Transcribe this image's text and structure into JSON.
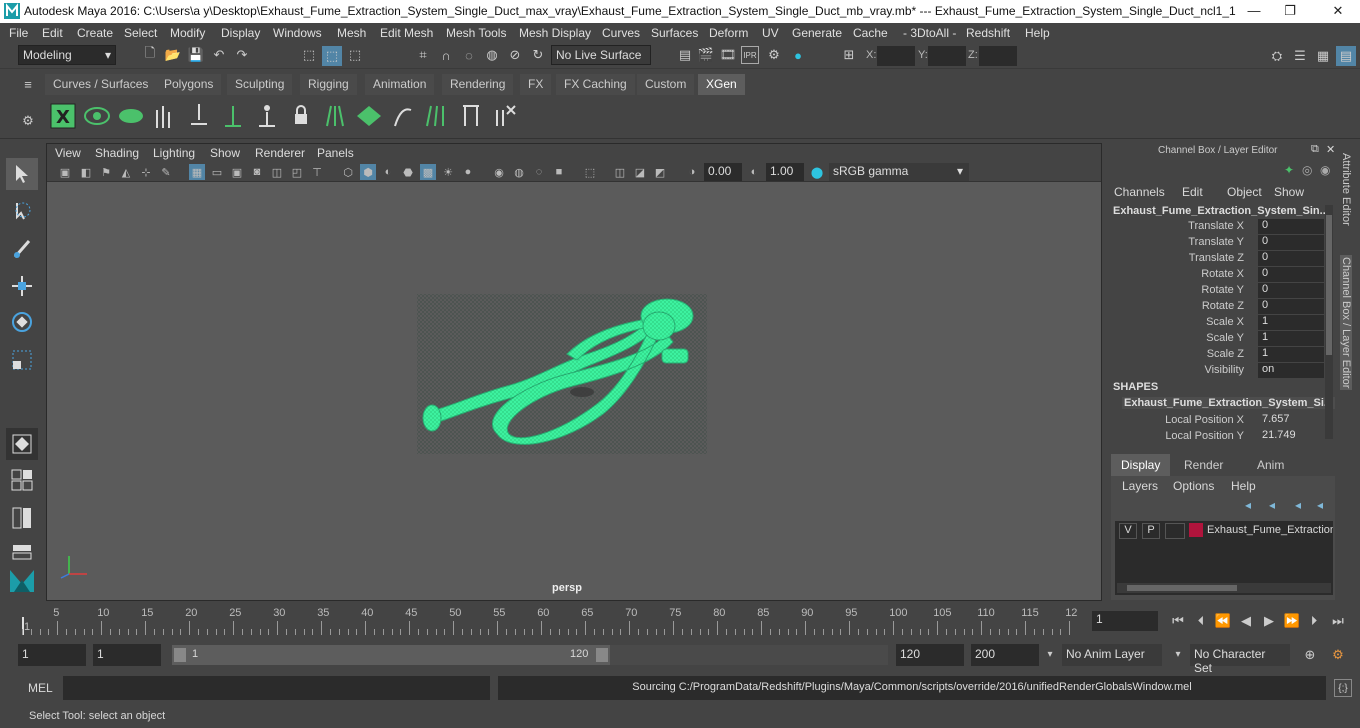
{
  "window": {
    "title": "Autodesk Maya 2016: C:\\Users\\a y\\Desktop\\Exhaust_Fume_Extraction_System_Single_Duct_max_vray\\Exhaust_Fume_Extraction_System_Single_Duct_mb_vray.mb*   ---   Exhaust_Fume_Extraction_System_Single_Duct_ncl1_1"
  },
  "menubar": [
    "File",
    "Edit",
    "Create",
    "Select",
    "Modify",
    "Display",
    "Windows",
    "Mesh",
    "Edit Mesh",
    "Mesh Tools",
    "Mesh Display",
    "Curves",
    "Surfaces",
    "Deform",
    "UV",
    "Generate",
    "Cache",
    "- 3DtoAll -",
    "Redshift",
    "Help"
  ],
  "status": {
    "mode": "Modeling",
    "live_surface": "No Live Surface",
    "x_label": "X:",
    "y_label": "Y:",
    "z_label": "Z:"
  },
  "shelf_tabs": [
    "Curves / Surfaces",
    "Polygons",
    "Sculpting",
    "Rigging",
    "Animation",
    "Rendering",
    "FX",
    "FX Caching",
    "Custom",
    "XGen"
  ],
  "active_shelf": "XGen",
  "viewport": {
    "menu": [
      "View",
      "Shading",
      "Lighting",
      "Show",
      "Renderer",
      "Panels"
    ],
    "exposure": "0.00",
    "gamma": "1.00",
    "color_space": "sRGB gamma",
    "camera": "persp"
  },
  "channel_box": {
    "header": "Channel Box / Layer Editor",
    "menu": [
      "Channels",
      "Edit",
      "Object",
      "Show"
    ],
    "object": "Exhaust_Fume_Extraction_System_Sin...",
    "attrs": [
      {
        "name": "Translate X",
        "value": "0"
      },
      {
        "name": "Translate Y",
        "value": "0"
      },
      {
        "name": "Translate Z",
        "value": "0"
      },
      {
        "name": "Rotate X",
        "value": "0"
      },
      {
        "name": "Rotate Y",
        "value": "0"
      },
      {
        "name": "Rotate Z",
        "value": "0"
      },
      {
        "name": "Scale X",
        "value": "1"
      },
      {
        "name": "Scale Y",
        "value": "1"
      },
      {
        "name": "Scale Z",
        "value": "1"
      },
      {
        "name": "Visibility",
        "value": "on"
      }
    ],
    "shapes_label": "SHAPES",
    "shape": "Exhaust_Fume_Extraction_System_Si...",
    "shape_attrs": [
      {
        "name": "Local Position X",
        "value": "7.657"
      },
      {
        "name": "Local Position Y",
        "value": "21.749"
      }
    ]
  },
  "layer_editor": {
    "tabs": [
      "Display",
      "Render",
      "Anim"
    ],
    "menu": [
      "Layers",
      "Options",
      "Help"
    ],
    "layer": {
      "v": "V",
      "p": "P",
      "name": "Exhaust_Fume_Extraction"
    }
  },
  "side_tabs": [
    "Attribute Editor",
    "Channel Box / Layer Editor"
  ],
  "timeline": {
    "ticks": [
      "5",
      "10",
      "15",
      "20",
      "25",
      "30",
      "35",
      "40",
      "45",
      "50",
      "55",
      "60",
      "65",
      "70",
      "75",
      "80",
      "85",
      "90",
      "95",
      "100",
      "105",
      "110",
      "115",
      "12"
    ],
    "start_marker": "1",
    "current": "1"
  },
  "range": {
    "start": "1",
    "inner_start": "1",
    "slider_start": "1",
    "slider_end": "120",
    "end": "120",
    "max": "200",
    "anim_layer": "No Anim Layer",
    "char_set": "No Character Set"
  },
  "cmd": {
    "lang": "MEL",
    "output": "Sourcing C:/ProgramData/Redshift/Plugins/Maya/Common/scripts/override/2016/unifiedRenderGlobalsWindow.mel"
  },
  "help_line": "Select Tool: select an object",
  "colors": {
    "mesh": "#3df2a0",
    "accent": "#5285a6",
    "layer_color": "#b0143c"
  }
}
